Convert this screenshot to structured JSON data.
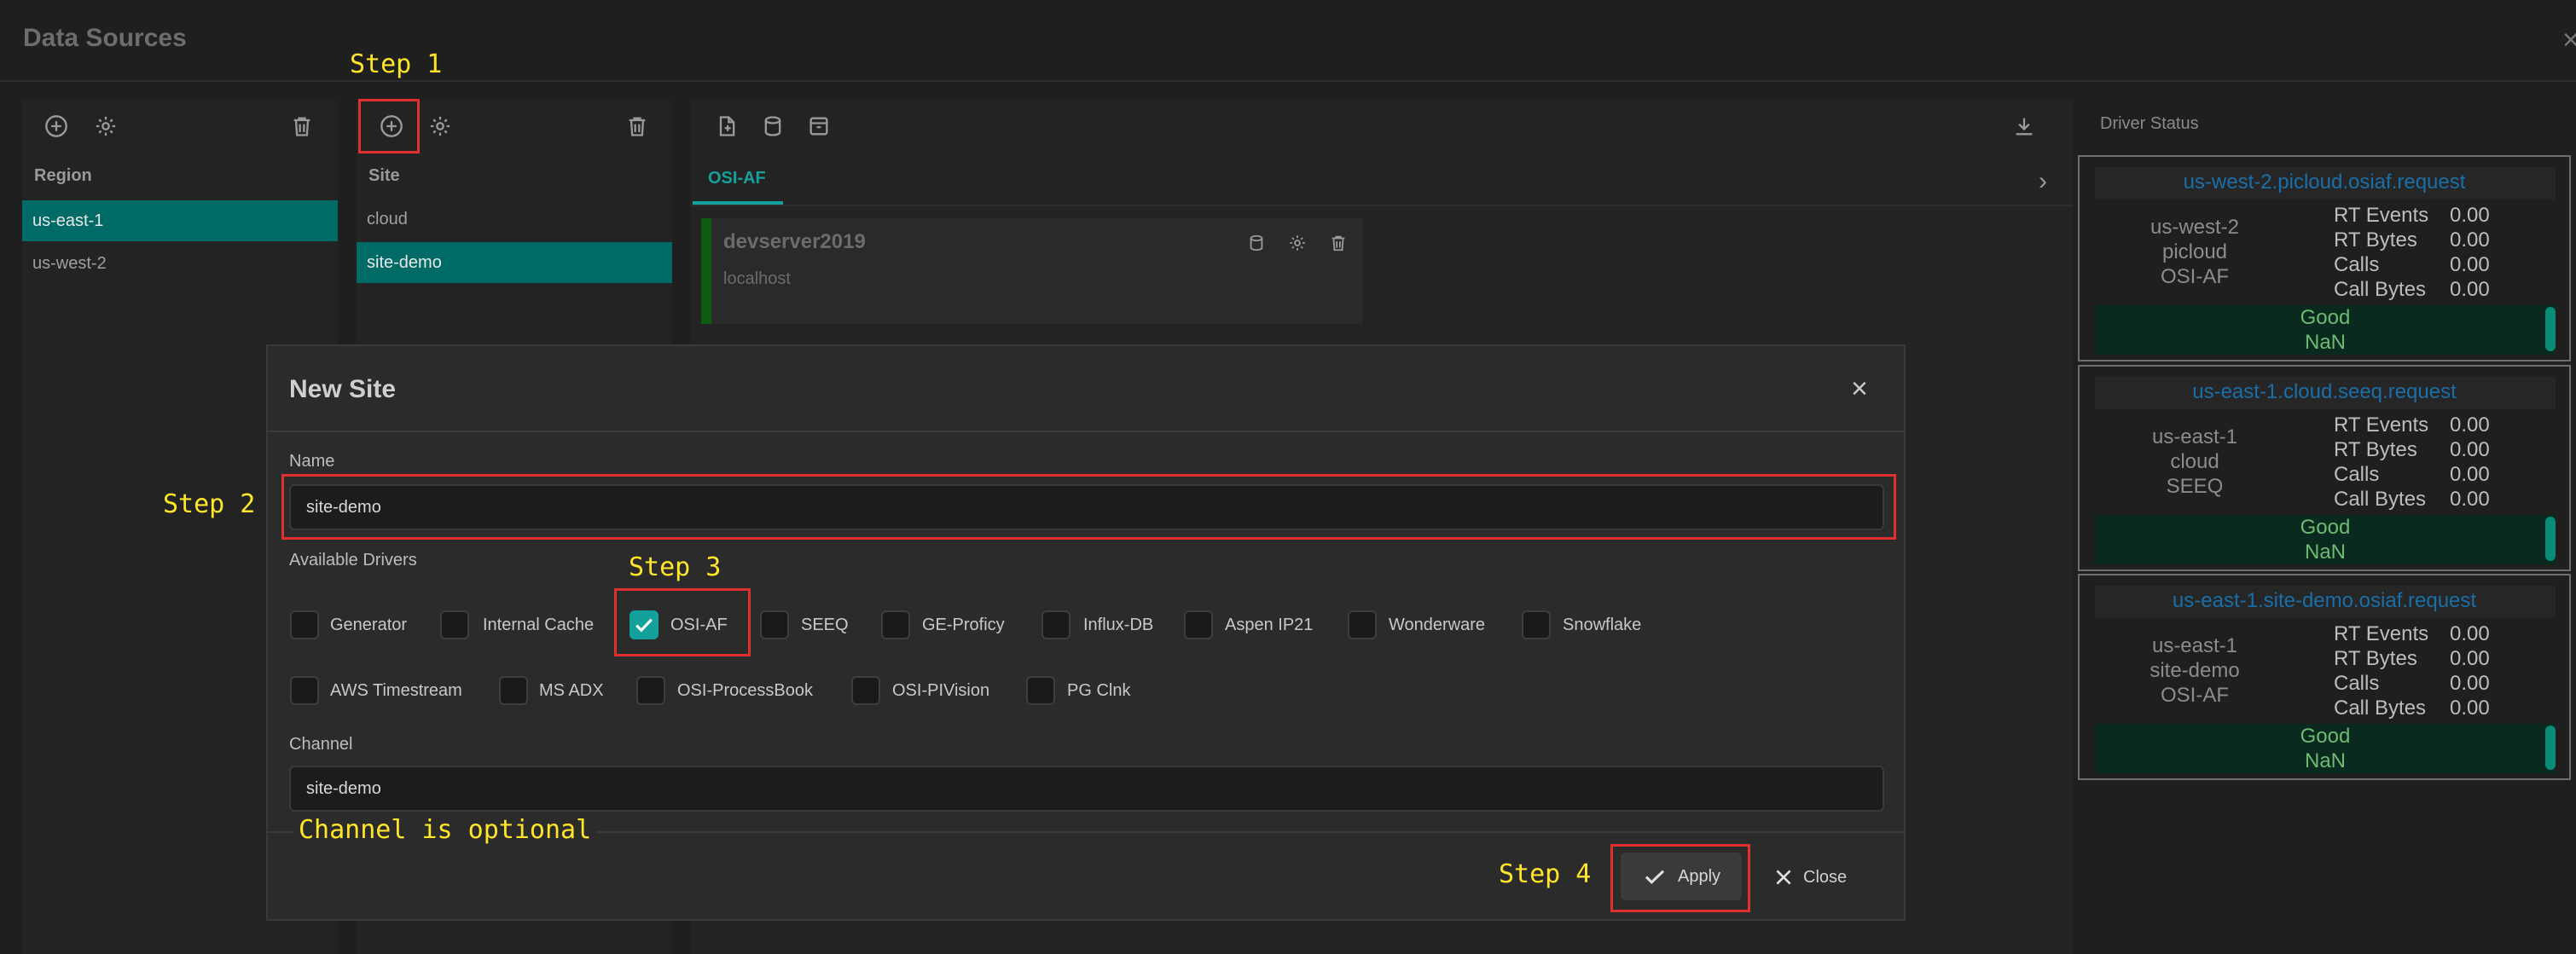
{
  "app": {
    "title": "Data Sources",
    "close_glyph": "×"
  },
  "region": {
    "header": "Region",
    "items": [
      "us-east-1",
      "us-west-2"
    ],
    "selected": "us-east-1"
  },
  "site": {
    "header": "Site",
    "items": [
      "cloud",
      "site-demo"
    ],
    "selected": "site-demo"
  },
  "sources": {
    "tabs": [
      "OSI-AF"
    ],
    "server": {
      "name": "devserver2019",
      "host": "localhost"
    }
  },
  "driver_status": {
    "header": "Driver Status",
    "stat_labels": [
      "RT Events",
      "RT Bytes",
      "Calls",
      "Call Bytes"
    ],
    "drivers": [
      {
        "title": "us-west-2.picloud.osiaf.request",
        "region": "us-west-2",
        "site": "picloud",
        "driver": "OSI-AF",
        "stats": [
          "0.00",
          "0.00",
          "0.00",
          "0.00"
        ],
        "status": "Good",
        "status_sub": "NaN"
      },
      {
        "title": "us-east-1.cloud.seeq.request",
        "region": "us-east-1",
        "site": "cloud",
        "driver": "SEEQ",
        "stats": [
          "0.00",
          "0.00",
          "0.00",
          "0.00"
        ],
        "status": "Good",
        "status_sub": "NaN"
      },
      {
        "title": "us-east-1.site-demo.osiaf.request",
        "region": "us-east-1",
        "site": "site-demo",
        "driver": "OSI-AF",
        "stats": [
          "0.00",
          "0.00",
          "0.00",
          "0.00"
        ],
        "status": "Good",
        "status_sub": "NaN"
      }
    ]
  },
  "modal": {
    "title": "New Site",
    "name_label": "Name",
    "name_value": "site-demo",
    "drivers_label": "Available Drivers",
    "drivers": [
      {
        "label": "Generator",
        "checked": false
      },
      {
        "label": "Internal Cache",
        "checked": false
      },
      {
        "label": "OSI-AF",
        "checked": true
      },
      {
        "label": "SEEQ",
        "checked": false
      },
      {
        "label": "GE-Proficy",
        "checked": false
      },
      {
        "label": "Influx-DB",
        "checked": false
      },
      {
        "label": "Aspen IP21",
        "checked": false
      },
      {
        "label": "Wonderware",
        "checked": false
      },
      {
        "label": "Snowflake",
        "checked": false
      },
      {
        "label": "AWS Timestream",
        "checked": false
      },
      {
        "label": "MS ADX",
        "checked": false
      },
      {
        "label": "OSI-ProcessBook",
        "checked": false
      },
      {
        "label": "OSI-PIVision",
        "checked": false
      },
      {
        "label": "PG Clnk",
        "checked": false
      }
    ],
    "channel_label": "Channel",
    "channel_value": "site-demo",
    "apply_label": "Apply",
    "close_label": "Close"
  },
  "annotations": {
    "step1": "Step 1",
    "step2": "Step 2",
    "step3": "Step 3",
    "step4": "Step 4",
    "channel_note": "Channel is optional"
  },
  "colors": {
    "accent": "#14a19b",
    "selected_row": "#006a66",
    "annotation": "#ffe629",
    "highlight_box": "#e03030",
    "driver_title": "#1a6fa8"
  }
}
